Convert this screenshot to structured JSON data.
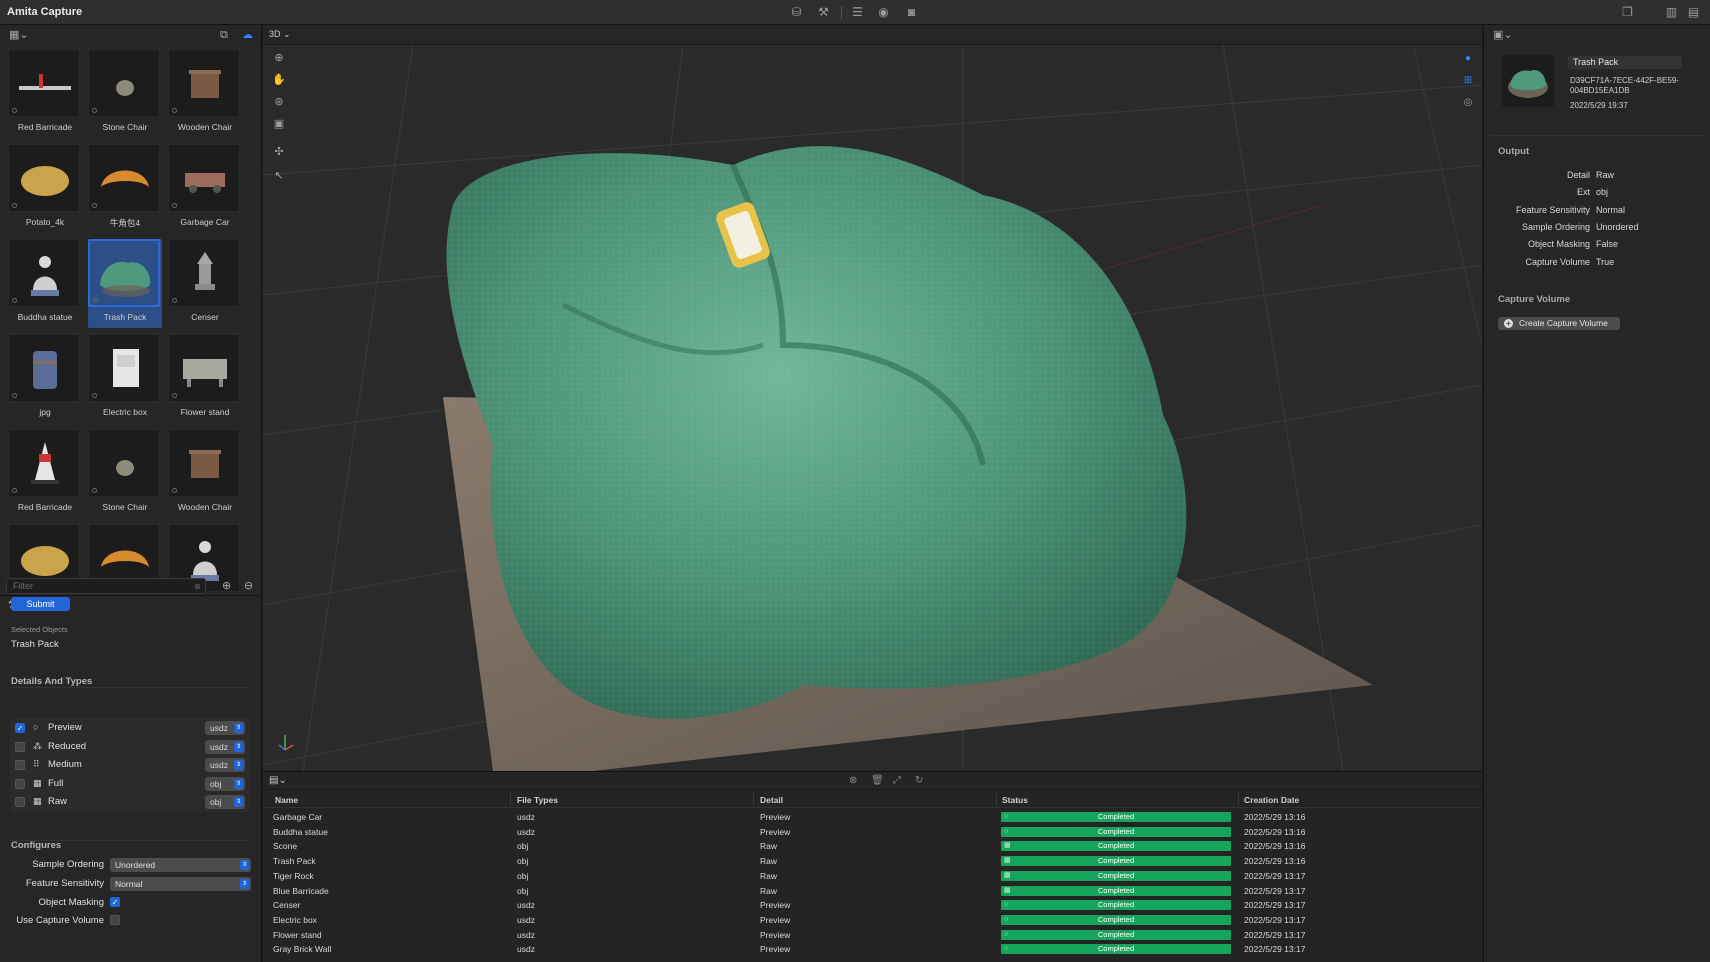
{
  "app": {
    "title": "Amita Capture"
  },
  "library": {
    "filter_placeholder": "Filter",
    "items": [
      {
        "label": "Red Barricade",
        "shape": "barricade"
      },
      {
        "label": "Stone Chair",
        "shape": "stone"
      },
      {
        "label": "Wooden Chair",
        "shape": "box"
      },
      {
        "label": "Potato_4k",
        "shape": "potato"
      },
      {
        "label": "牛角包4",
        "shape": "croissant"
      },
      {
        "label": "Garbage Car",
        "shape": "cart"
      },
      {
        "label": "Buddha statue",
        "shape": "statue"
      },
      {
        "label": "Trash Pack",
        "shape": "bag",
        "selected": true
      },
      {
        "label": "Censer",
        "shape": "censer"
      },
      {
        "label": "jpg",
        "shape": "barrel"
      },
      {
        "label": "Electric box",
        "shape": "cabinet"
      },
      {
        "label": "Flower stand",
        "shape": "stand"
      },
      {
        "label": "Red Barricade",
        "shape": "cone"
      },
      {
        "label": "Stone Chair",
        "shape": "stone"
      },
      {
        "label": "Wooden Chair",
        "shape": "box"
      },
      {
        "label": "",
        "shape": "potato"
      },
      {
        "label": "",
        "shape": "croissant"
      },
      {
        "label": "",
        "shape": "statue"
      }
    ]
  },
  "request": {
    "submit_label": "Submit",
    "selected_objects_label": "Selected Objects",
    "selected_objects_value": "Trash Pack",
    "details_title": "Details And Types",
    "details": [
      {
        "label": "Preview",
        "format": "usdz",
        "checked": true,
        "icon": "○"
      },
      {
        "label": "Reduced",
        "format": "usdz",
        "checked": false,
        "icon": "⁂"
      },
      {
        "label": "Medium",
        "format": "usdz",
        "checked": false,
        "icon": "⠿"
      },
      {
        "label": "Full",
        "format": "obj",
        "checked": false,
        "icon": "▦"
      },
      {
        "label": "Raw",
        "format": "obj",
        "checked": false,
        "icon": "▦"
      }
    ],
    "configures_title": "Configures",
    "sample_ordering_label": "Sample Ordering",
    "sample_ordering_value": "Unordered",
    "feature_sensitivity_label": "Feature Sensitivity",
    "feature_sensitivity_value": "Normal",
    "object_masking_label": "Object Masking",
    "object_masking": true,
    "use_capture_volume_label": "Use Capture Volume",
    "use_capture_volume": false
  },
  "viewport": {
    "mode": "3D ⌄"
  },
  "jobs": {
    "columns": [
      "Name",
      "File Types",
      "Detail",
      "Status",
      "Creation Date"
    ],
    "rows": [
      {
        "name": "Garbage Car",
        "type": "usdz",
        "detail": "Preview",
        "status": "Completed",
        "date": "2022/5/29 13:16"
      },
      {
        "name": "Buddha statue",
        "type": "usdz",
        "detail": "Preview",
        "status": "Completed",
        "date": "2022/5/29 13:16"
      },
      {
        "name": "Scone",
        "type": "obj",
        "detail": "Raw",
        "status": "Completed",
        "date": "2022/5/29 13:16"
      },
      {
        "name": "Trash Pack",
        "type": "obj",
        "detail": "Raw",
        "status": "Completed",
        "date": "2022/5/29 13:16"
      },
      {
        "name": "Tiger Rock",
        "type": "obj",
        "detail": "Raw",
        "status": "Completed",
        "date": "2022/5/29 13:17"
      },
      {
        "name": "Blue Barricade",
        "type": "obj",
        "detail": "Raw",
        "status": "Completed",
        "date": "2022/5/29 13:17"
      },
      {
        "name": "Censer",
        "type": "usdz",
        "detail": "Preview",
        "status": "Completed",
        "date": "2022/5/29 13:17"
      },
      {
        "name": "Electric box",
        "type": "usdz",
        "detail": "Preview",
        "status": "Completed",
        "date": "2022/5/29 13:17"
      },
      {
        "name": "Flower stand",
        "type": "usdz",
        "detail": "Preview",
        "status": "Completed",
        "date": "2022/5/29 13:17"
      },
      {
        "name": "Gray Brick Wall",
        "type": "usdz",
        "detail": "Preview",
        "status": "Completed",
        "date": "2022/5/29 13:17"
      }
    ]
  },
  "inspector": {
    "name": "Trash Pack",
    "id": "D39CF71A-7ECE-442F-BE59-004BD15EA1DB",
    "date": "2022/5/29 19:37",
    "output_title": "Output",
    "output": [
      {
        "key": "Detail",
        "value": "Raw"
      },
      {
        "key": "Ext",
        "value": "obj"
      },
      {
        "key": "Feature Sensitivity",
        "value": "Normal"
      },
      {
        "key": "Sample Ordering",
        "value": "Unordered"
      },
      {
        "key": "Object Masking",
        "value": "False"
      },
      {
        "key": "Capture Volume",
        "value": "True"
      }
    ],
    "capture_volume_title": "Capture Volume",
    "create_volume_label": "Create Capture Volume"
  },
  "colors": {
    "accent": "#2266d6",
    "status_ok": "#16a55d",
    "bag": "#4f9a7c"
  }
}
